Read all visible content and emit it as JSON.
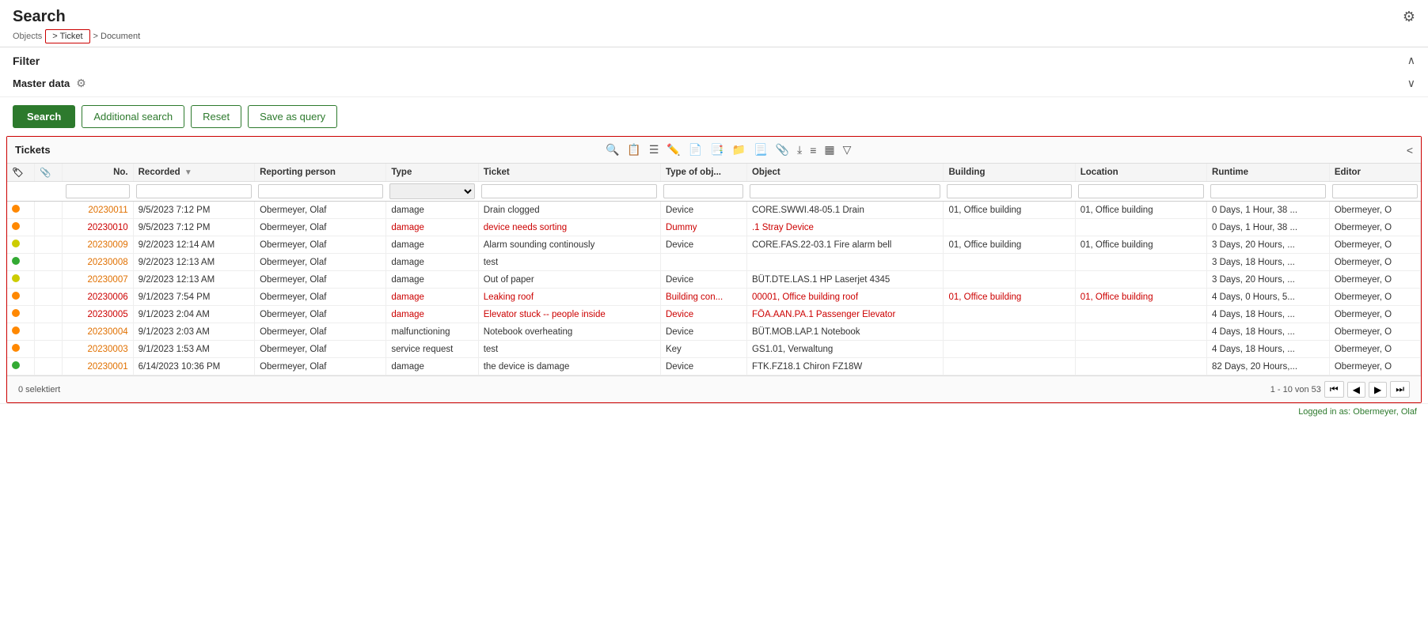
{
  "header": {
    "title": "Search",
    "objects_label": "Objects",
    "breadcrumb_ticket": "> Ticket",
    "breadcrumb_doc": "> Document",
    "gear_icon": "⚙"
  },
  "filter": {
    "label": "Filter",
    "chevron": "∧",
    "master_data_label": "Master data",
    "master_data_chevron": "∨"
  },
  "actions": {
    "search_label": "Search",
    "additional_search_label": "Additional search",
    "reset_label": "Reset",
    "save_as_query_label": "Save as query"
  },
  "tickets_section": {
    "title": "Tickets",
    "collapse_icon": "<"
  },
  "table": {
    "columns": [
      "",
      "",
      "No.",
      "Recorded",
      "Reporting person",
      "Type",
      "Ticket",
      "Type of obj...",
      "Object",
      "Building",
      "Location",
      "Runtime",
      "Editor"
    ],
    "rows": [
      {
        "status": "orange",
        "no": "20230011",
        "recorded": "9/5/2023 7:12 PM",
        "person": "Obermeyer, Olaf",
        "type": "damage",
        "ticket": "Drain clogged",
        "typeobj": "Device",
        "object": "CORE.SWWI.48-05.1 Drain",
        "building": "01, Office building",
        "location": "01, Office building",
        "runtime": "0 Days, 1 Hour, 38 ...",
        "editor": "Obermeyer, O",
        "link": false
      },
      {
        "status": "orange",
        "no": "20230010",
        "recorded": "9/5/2023 7:12 PM",
        "person": "Obermeyer, Olaf",
        "type": "damage",
        "ticket": "device needs sorting",
        "typeobj": "Dummy",
        "object": ".1 Stray Device",
        "building": "",
        "location": "",
        "runtime": "0 Days, 1 Hour, 38 ...",
        "editor": "Obermeyer, O",
        "link": true
      },
      {
        "status": "yellow",
        "no": "20230009",
        "recorded": "9/2/2023 12:14 AM",
        "person": "Obermeyer, Olaf",
        "type": "damage",
        "ticket": "Alarm sounding continously",
        "typeobj": "Device",
        "object": "CORE.FAS.22-03.1 Fire alarm bell",
        "building": "01, Office building",
        "location": "01, Office building",
        "runtime": "3 Days, 20 Hours, ...",
        "editor": "Obermeyer, O",
        "link": false
      },
      {
        "status": "green",
        "no": "20230008",
        "recorded": "9/2/2023 12:13 AM",
        "person": "Obermeyer, Olaf",
        "type": "damage",
        "ticket": "test",
        "typeobj": "",
        "object": "",
        "building": "",
        "location": "",
        "runtime": "3 Days, 18 Hours, ...",
        "editor": "Obermeyer, O",
        "link": false
      },
      {
        "status": "yellow",
        "no": "20230007",
        "recorded": "9/2/2023 12:13 AM",
        "person": "Obermeyer, Olaf",
        "type": "damage",
        "ticket": "Out of paper",
        "typeobj": "Device",
        "object": "BÜT.DTE.LAS.1 HP Laserjet 4345",
        "building": "",
        "location": "",
        "runtime": "3 Days, 20 Hours, ...",
        "editor": "Obermeyer, O",
        "link": false
      },
      {
        "status": "orange",
        "no": "20230006",
        "recorded": "9/1/2023 7:54 PM",
        "person": "Obermeyer, Olaf",
        "type": "damage",
        "ticket": "Leaking roof",
        "typeobj": "Building con...",
        "object": "00001, Office building roof",
        "building": "01, Office building",
        "location": "01, Office building",
        "runtime": "4 Days, 0 Hours, 5...",
        "editor": "Obermeyer, O",
        "link": true
      },
      {
        "status": "orange",
        "no": "20230005",
        "recorded": "9/1/2023 2:04 AM",
        "person": "Obermeyer, Olaf",
        "type": "damage",
        "ticket": "Elevator stuck -- people inside",
        "typeobj": "Device",
        "object": "FÖA.AAN.PA.1 Passenger Elevator",
        "building": "",
        "location": "",
        "runtime": "4 Days, 18 Hours, ...",
        "editor": "Obermeyer, O",
        "link": true
      },
      {
        "status": "orange",
        "no": "20230004",
        "recorded": "9/1/2023 2:03 AM",
        "person": "Obermeyer, Olaf",
        "type": "malfunctioning",
        "ticket": "Notebook overheating",
        "typeobj": "Device",
        "object": "BÜT.MOB.LAP.1 Notebook",
        "building": "",
        "location": "",
        "runtime": "4 Days, 18 Hours, ...",
        "editor": "Obermeyer, O",
        "link": false
      },
      {
        "status": "orange",
        "no": "20230003",
        "recorded": "9/1/2023 1:53 AM",
        "person": "Obermeyer, Olaf",
        "type": "service request",
        "ticket": "test",
        "typeobj": "Key",
        "object": "GS1.01, Verwaltung",
        "building": "",
        "location": "",
        "runtime": "4 Days, 18 Hours, ...",
        "editor": "Obermeyer, O",
        "link": false
      },
      {
        "status": "green",
        "no": "20230001",
        "recorded": "6/14/2023 10:36 PM",
        "person": "Obermeyer, Olaf",
        "type": "damage",
        "ticket": "the device is damage",
        "typeobj": "Device",
        "object": "FTK.FZ18.1 Chiron FZ18W",
        "building": "",
        "location": "",
        "runtime": "82 Days, 20 Hours,...",
        "editor": "Obermeyer, O",
        "link": false
      }
    ]
  },
  "footer": {
    "selected": "0 selektiert",
    "pagination": "1 - 10 von 53",
    "logged_in": "Logged in as: Obermeyer, Olaf"
  }
}
